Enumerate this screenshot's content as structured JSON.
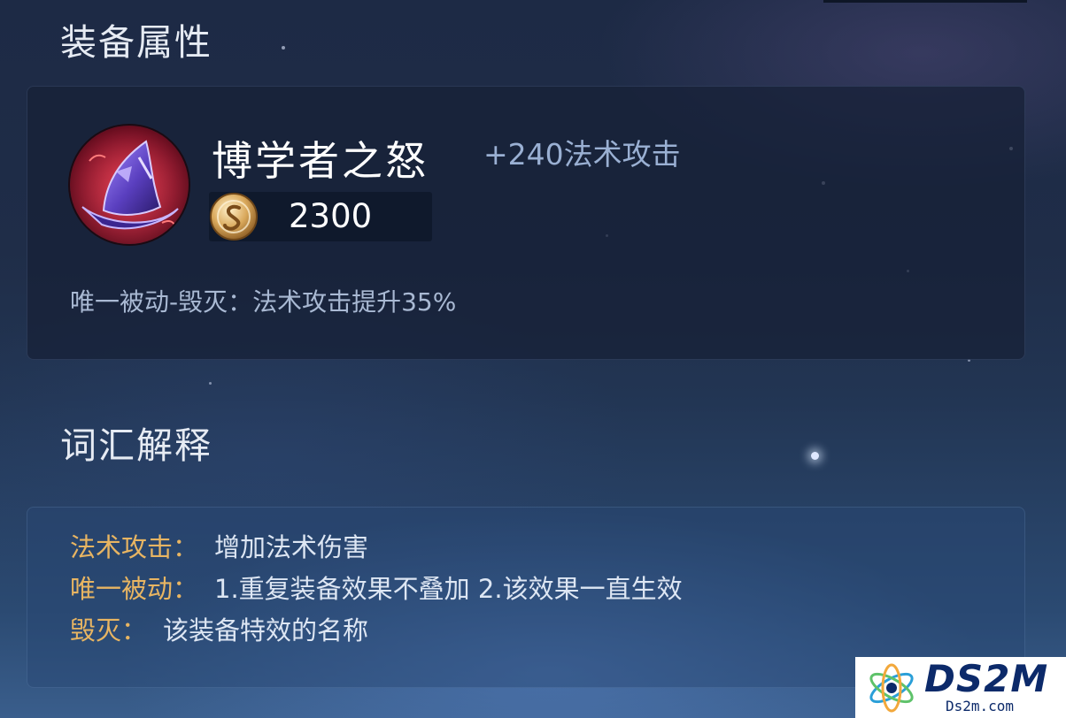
{
  "sections": {
    "equipment_title": "装备属性",
    "glossary_title": "词汇解释"
  },
  "item": {
    "name": "博学者之怒",
    "stat": "+240法术攻击",
    "price": "2300",
    "passive": "唯一被动-毁灭：法术攻击提升35%",
    "icon": "wizard-hat-icon",
    "currency_icon": "gold-coin-icon"
  },
  "glossary": [
    {
      "term": "法术攻击：",
      "definition": "增加法术伤害"
    },
    {
      "term": "唯一被动：",
      "definition": "1.重复装备效果不叠加 2.该效果一直生效"
    },
    {
      "term": "毁灭：",
      "definition": "该装备特效的名称"
    }
  ],
  "watermark": {
    "title": "DS2M",
    "subtitle": "Ds2m.com"
  },
  "colors": {
    "term": "#e8b562",
    "stat": "#9ab0d3",
    "background": "#1f2d48"
  }
}
